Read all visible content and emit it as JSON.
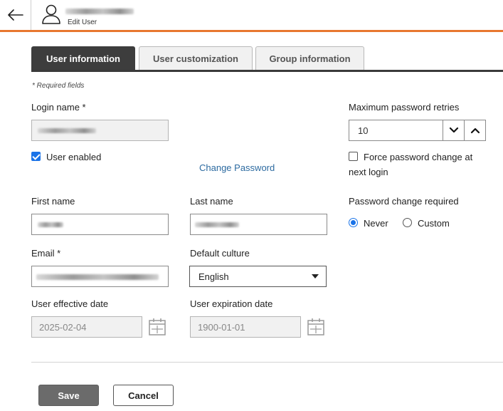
{
  "header": {
    "subtitle": "Edit User"
  },
  "tabs": [
    {
      "label": "User information",
      "active": true
    },
    {
      "label": "User customization",
      "active": false
    },
    {
      "label": "Group information",
      "active": false
    }
  ],
  "form": {
    "required_note": "* Required fields",
    "login_name_label": "Login name *",
    "user_enabled_label": "User enabled",
    "user_enabled_checked": true,
    "change_password_link": "Change Password",
    "first_name_label": "First name",
    "last_name_label": "Last name",
    "email_label": "Email *",
    "default_culture_label": "Default culture",
    "default_culture_value": "English",
    "effective_date_label": "User effective date",
    "effective_date_value": "2025-02-04",
    "expiration_date_label": "User expiration date",
    "expiration_date_value": "1900-01-01",
    "max_retries_label": "Maximum password retries",
    "max_retries_value": "10",
    "force_change_label_line1": "Force password change at",
    "force_change_label_line2": "next login",
    "force_change_checked": false,
    "pw_change_required_label": "Password change required",
    "pw_option_never": "Never",
    "pw_option_custom": "Custom",
    "pw_selected": "Never"
  },
  "actions": {
    "save_label": "Save",
    "cancel_label": "Cancel"
  },
  "colors": {
    "accent": "#e8782f",
    "tab_active": "#3d3d3d",
    "link": "#2c6aa0",
    "control_blue": "#1a73e8"
  }
}
